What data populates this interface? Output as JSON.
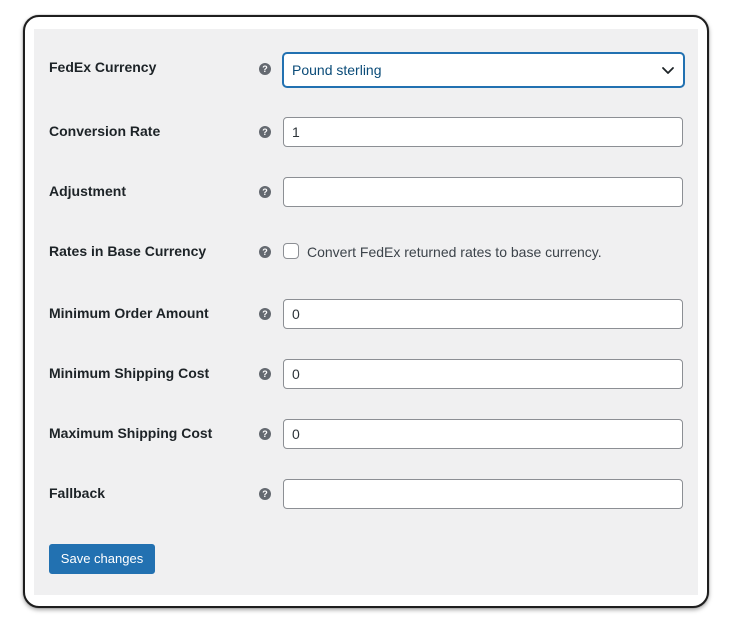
{
  "settings": {
    "currency": {
      "label": "FedEx Currency",
      "help": "?",
      "value": "Pound sterling"
    },
    "conversion_rate": {
      "label": "Conversion Rate",
      "help": "?",
      "value": "1"
    },
    "adjustment": {
      "label": "Adjustment",
      "help": "?",
      "value": ""
    },
    "base_currency": {
      "label": "Rates in Base Currency",
      "help": "?",
      "checkbox_label": "Convert FedEx returned rates to base currency.",
      "checked": false
    },
    "min_order": {
      "label": "Minimum Order Amount",
      "help": "?",
      "value": "0"
    },
    "min_shipping": {
      "label": "Minimum Shipping Cost",
      "help": "?",
      "value": "0"
    },
    "max_shipping": {
      "label": "Maximum Shipping Cost",
      "help": "?",
      "value": "0"
    },
    "fallback": {
      "label": "Fallback",
      "help": "?",
      "value": ""
    }
  },
  "actions": {
    "save_label": "Save changes"
  },
  "icons": {
    "help": "question-circle-icon",
    "dropdown": "chevron-down-icon"
  },
  "colors": {
    "accent": "#2271b1",
    "panel": "#f0f0f1",
    "text": "#1d2327"
  }
}
